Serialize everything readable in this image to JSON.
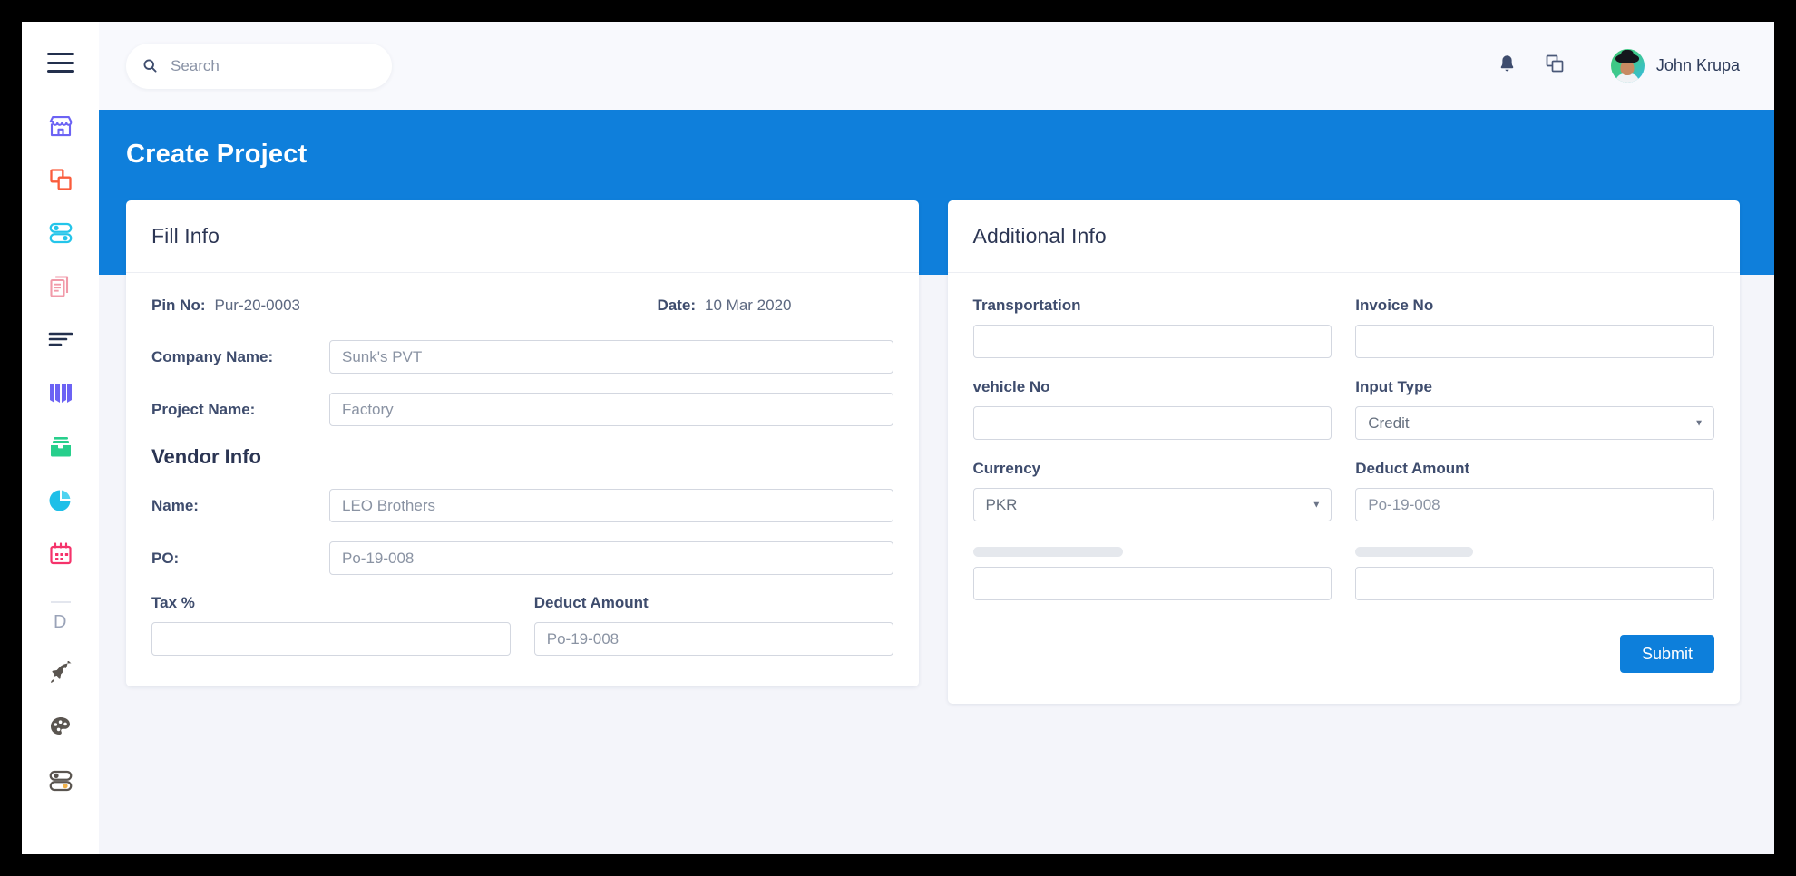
{
  "theme": {
    "accent": "#0f7fdb",
    "page_bg": "#f4f5fa",
    "card_bg": "#ffffff",
    "heading_color": "#2b3553",
    "label_color": "#3e4c6d",
    "submit_bg": "#0d7fdb"
  },
  "sidebar": {
    "menu_icon": "hamburger-icon",
    "items": [
      {
        "icon": "storefront-icon",
        "color": "#6c63f4"
      },
      {
        "icon": "layers-copy-icon",
        "color": "#fa5c3c"
      },
      {
        "icon": "toggles-icon",
        "color": "#24c5ea"
      },
      {
        "icon": "documents-icon",
        "color": "#f19aa9"
      },
      {
        "icon": "list-lines-icon",
        "color": "#2b3553"
      },
      {
        "icon": "open-book-icon",
        "color": "#6c63f4"
      },
      {
        "icon": "archive-box-icon",
        "color": "#27cf8c"
      },
      {
        "icon": "pie-chart-icon",
        "color": "#24c5ea"
      },
      {
        "icon": "calendar-icon",
        "color": "#f5336b"
      }
    ],
    "group_label": "D",
    "bottom_items": [
      {
        "icon": "rocket-icon",
        "color": "#5a5550"
      },
      {
        "icon": "palette-icon",
        "color": "#5a5550"
      },
      {
        "icon": "toggles-alt-icon",
        "color": "#5a5550"
      }
    ]
  },
  "topbar": {
    "search": {
      "icon": "search-icon",
      "value": "",
      "placeholder": "Search"
    },
    "notifications_icon": "bell-icon",
    "duplicate_icon": "copy-icon",
    "user": {
      "name": "John Krupa",
      "avatar": "avatar"
    }
  },
  "page": {
    "title": "Create Project"
  },
  "fill_info": {
    "heading": "Fill Info",
    "pin_no_label": "Pin No:",
    "pin_no_value": "Pur-20-0003",
    "date_label": "Date:",
    "date_value": "10 Mar 2020",
    "company_name_label": "Company Name:",
    "company_name_value": "Sunk's PVT",
    "project_name_label": "Project Name:",
    "project_name_value": "Factory",
    "vendor_section_title": "Vendor Info",
    "vendor_name_label": "Name:",
    "vendor_name_value": "LEO Brothers",
    "po_label": "PO:",
    "po_value": "Po-19-008",
    "tax_label": "Tax %",
    "tax_value": "",
    "deduct_label": "Deduct Amount",
    "deduct_value": "Po-19-008"
  },
  "additional_info": {
    "heading": "Additional Info",
    "transportation_label": "Transportation",
    "transportation_value": "",
    "invoice_no_label": "Invoice No",
    "invoice_no_value": "",
    "vehicle_no_label": "vehicle No",
    "vehicle_no_value": "",
    "input_type_label": "Input Type",
    "input_type_value": "Credit",
    "input_type_options": [
      "Credit"
    ],
    "currency_label": "Currency",
    "currency_value": "PKR",
    "currency_options": [
      "PKR"
    ],
    "deduct_amount_label": "Deduct Amount",
    "deduct_amount_value": "Po-19-008",
    "extra_left_value": "",
    "extra_right_value": "",
    "submit_label": "Submit"
  }
}
